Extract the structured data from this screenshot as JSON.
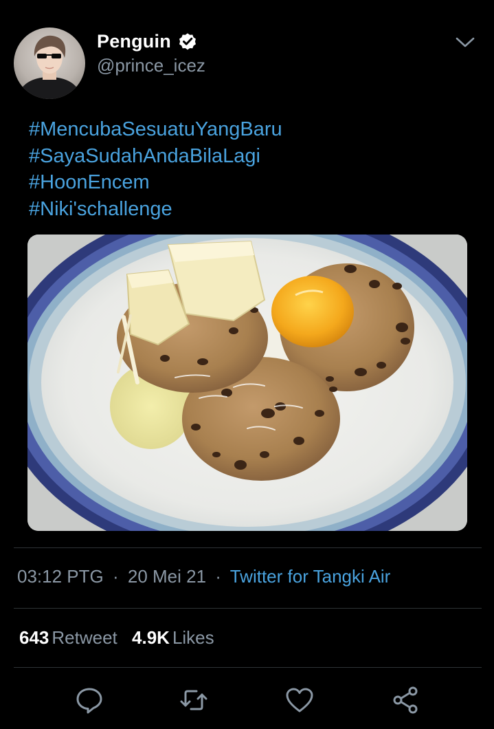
{
  "author": {
    "display_name": "Penguin",
    "handle": "@prince_icez",
    "verified_icon": "verified-badge-icon"
  },
  "tweet": {
    "hashtags": [
      "#MencubaSesuatuYangBaru",
      "#SayaSudahAndaBilaLagi",
      "#HoonEncem",
      "#Niki'schallenge"
    ]
  },
  "meta": {
    "time": "03:12 PTG",
    "separator": "·",
    "date": "20 Mei 21",
    "source": "Twitter for Tangki Air"
  },
  "stats": {
    "retweet_count": "643",
    "retweet_label": "Retweet",
    "likes_count": "4.9K",
    "likes_label": "Likes"
  },
  "actions": [
    "reply-icon",
    "retweet-icon",
    "like-icon",
    "share-icon"
  ],
  "colors": {
    "background": "#000000",
    "text_primary": "#ffffff",
    "text_secondary": "#8b98a5",
    "link": "#4aa3df",
    "divider": "#2f3336"
  }
}
